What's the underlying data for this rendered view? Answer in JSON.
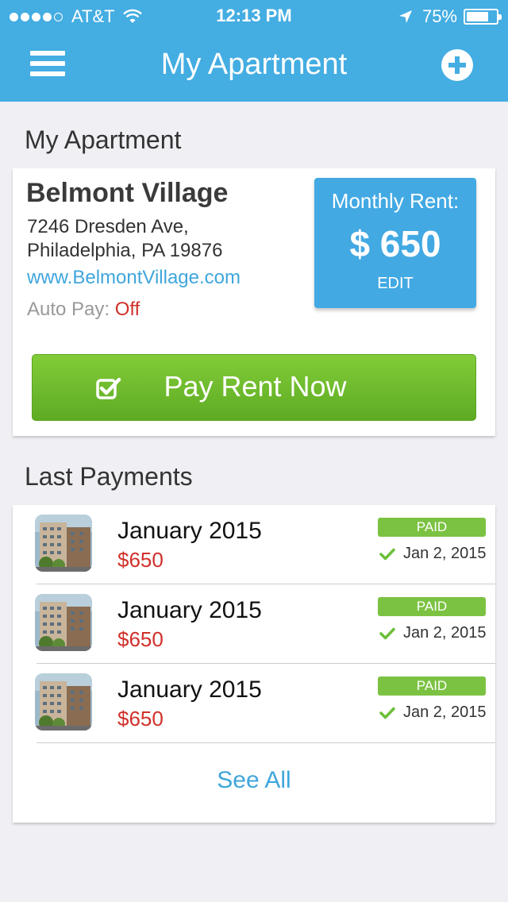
{
  "status_bar": {
    "carrier": "AT&T",
    "time": "12:13 PM",
    "battery": "75%",
    "battery_level": 0.75,
    "signal_bars_filled": 4,
    "signal_bars_total": 5
  },
  "nav": {
    "title": "My Apartment",
    "menu_icon": "hamburger-icon",
    "add_icon": "plus-circle-icon"
  },
  "apartment": {
    "section_title": "My Apartment",
    "name": "Belmont Village",
    "address_line1": "7246 Dresden Ave,",
    "address_line2": "Philadelphia, PA 19876",
    "website": "www.BelmontVillage.com",
    "autopay_label": "Auto Pay:",
    "autopay_value": "Off",
    "rent_label": "Monthly Rent:",
    "rent_value": "$ 650",
    "edit_label": "EDIT",
    "pay_button_label": "Pay Rent Now"
  },
  "payments": {
    "section_title": "Last Payments",
    "items": [
      {
        "month": "January 2015",
        "amount": "$650",
        "status": "PAID",
        "date": "Jan 2, 2015"
      },
      {
        "month": "January 2015",
        "amount": "$650",
        "status": "PAID",
        "date": "Jan 2, 2015"
      },
      {
        "month": "January 2015",
        "amount": "$650",
        "status": "PAID",
        "date": "Jan 2, 2015"
      }
    ],
    "see_all_label": "See All"
  },
  "colors": {
    "nav_blue": "#44ade2",
    "link_blue": "#3fa6dc",
    "paid_green": "#7cc242",
    "button_green": "#6bb82c",
    "amount_red": "#d0302a",
    "background": "#efeff4"
  }
}
